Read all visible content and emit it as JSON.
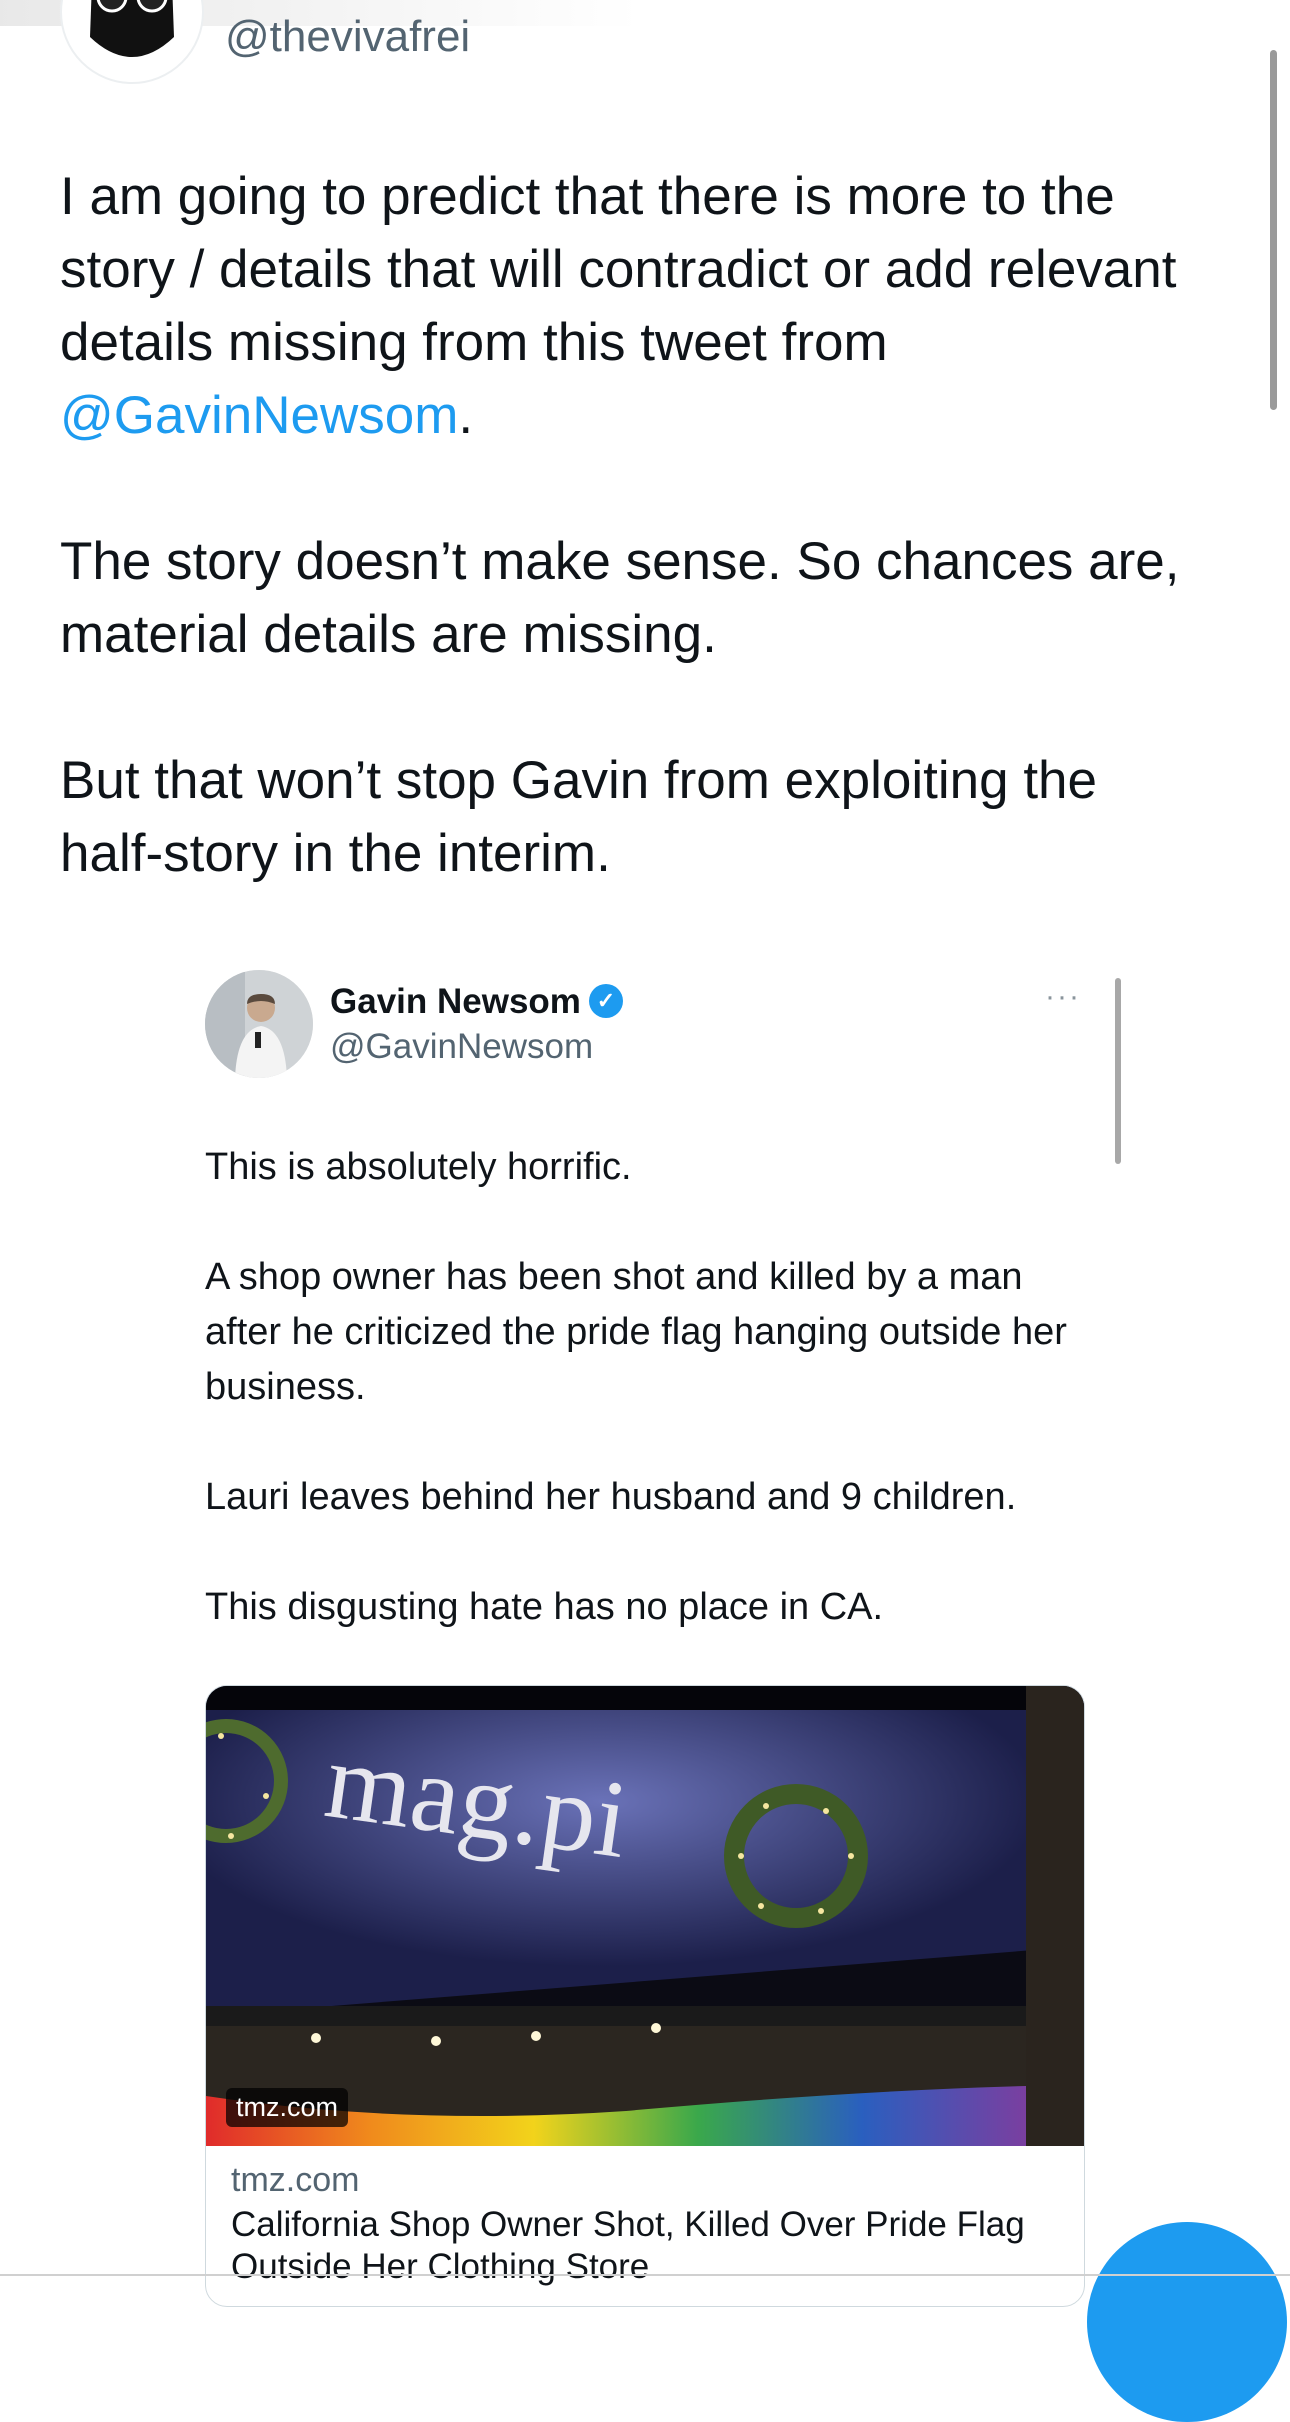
{
  "author": {
    "handle": "@thevivafrei"
  },
  "tweet": {
    "p1_text": "I am going to predict that there is more to the story / details that will contradict or add relevant details missing from this tweet from ",
    "p1_mention": "@GavinNewsom",
    "p1_end": ".",
    "p2": "The story doesn’t make sense. So chances are, material details are missing.",
    "p3": "But that won’t stop Gavin from exploiting the half-story in the interim."
  },
  "quoted": {
    "name": "Gavin Newsom",
    "handle": "@GavinNewsom",
    "more": "···",
    "verified_icon": "verified-badge",
    "paragraphs": [
      "This is absolutely horrific.",
      "A shop owner has been shot and killed by a man after he criticized the pride flag hanging outside her business.",
      "Lauri leaves behind her husband and 9 children.",
      "This disgusting hate has no place in CA."
    ],
    "card": {
      "image_sign_text": "mag.pi",
      "image_badge": "tmz.com",
      "domain": "tmz.com",
      "title": "California Shop Owner Shot, Killed Over Pride Flag Outside Her Clothing Store"
    }
  },
  "colors": {
    "accent": "#1d9bf0",
    "text": "#0f1419",
    "secondary": "#536471"
  }
}
